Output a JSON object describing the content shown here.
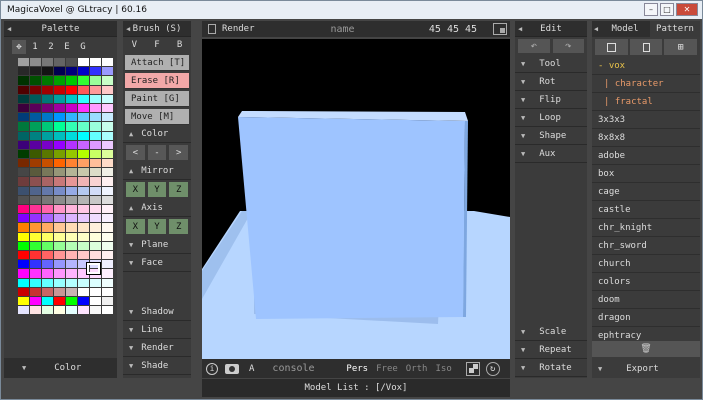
{
  "title": "MagicaVoxel @ GLtracy | 60.16",
  "window_controls": [
    "–",
    "□",
    "✕"
  ],
  "palette": {
    "header": "Palette",
    "tabs": [
      "✥",
      "1",
      "2",
      "E",
      "G"
    ],
    "footer": "Color",
    "colors": [
      "#a0a0a0",
      "#8c8c8c",
      "#787878",
      "#646464",
      "#505050",
      "#ffffff",
      "#ffffff",
      "#ffffff",
      "#282828",
      "#1e1e1e",
      "#141414",
      "#000050",
      "#00007c",
      "#0000c8",
      "#3232ff",
      "#9a9aff",
      "#003200",
      "#005000",
      "#007800",
      "#00a000",
      "#00c800",
      "#32ff32",
      "#9aff9a",
      "#c8ffc8",
      "#500000",
      "#780000",
      "#a00000",
      "#c80000",
      "#ff0000",
      "#ff5a5a",
      "#ff9a9a",
      "#ffc8c8",
      "#003c3c",
      "#005a5a",
      "#007878",
      "#00a0a0",
      "#00c8c8",
      "#32ffff",
      "#9affff",
      "#c8ffff",
      "#3c003c",
      "#5a005a",
      "#780078",
      "#a000a0",
      "#c800c8",
      "#ff32ff",
      "#ff9aff",
      "#ffc8ff",
      "#003c78",
      "#005aa0",
      "#0078c8",
      "#0096ff",
      "#32b4ff",
      "#64c8ff",
      "#9adcff",
      "#c8ecff",
      "#00783c",
      "#00a05a",
      "#00c878",
      "#00ff96",
      "#32ffb4",
      "#64ffc8",
      "#9affdc",
      "#c8ffec",
      "#006464",
      "#008282",
      "#00a0a0",
      "#00bebe",
      "#00dcdc",
      "#00ffff",
      "#64ffff",
      "#aaffff",
      "#3c0078",
      "#5a00a0",
      "#7800c8",
      "#9600ff",
      "#b432ff",
      "#c864ff",
      "#dc9aff",
      "#ecc8ff",
      "#003c00",
      "#3c5a00",
      "#5a7800",
      "#78a000",
      "#96c800",
      "#b4ff00",
      "#c8ff64",
      "#dcff9a",
      "#782800",
      "#a03c00",
      "#c85000",
      "#ff6400",
      "#ff8232",
      "#ffa064",
      "#ffbe9a",
      "#ffdcc8",
      "#464646",
      "#5a5a3c",
      "#78785a",
      "#969678",
      "#b4b496",
      "#c8c8aa",
      "#dcdcc8",
      "#f0f0e6",
      "#6e3c3c",
      "#8c5050",
      "#aa6464",
      "#c87878",
      "#e69696",
      "#f0b4b4",
      "#f8d2d2",
      "#fff0f0",
      "#3c506e",
      "#50648c",
      "#6478aa",
      "#788cc8",
      "#96aae6",
      "#b4c8f0",
      "#d2dcf8",
      "#f0f4ff",
      "#505050",
      "#646464",
      "#787878",
      "#8c8c8c",
      "#a0a0a0",
      "#b4b4b4",
      "#c8c8c8",
      "#dcdcdc",
      "#ff0080",
      "#ff3296",
      "#ff64aa",
      "#ff96c8",
      "#ffb4dc",
      "#ffc8e6",
      "#ffdcf0",
      "#fff0f8",
      "#8000ff",
      "#9632ff",
      "#aa64ff",
      "#c896ff",
      "#dcb4ff",
      "#e6c8ff",
      "#f0dcff",
      "#f8f0ff",
      "#ff8000",
      "#ff9632",
      "#ffaa64",
      "#ffc896",
      "#ffdcb4",
      "#ffe6c8",
      "#fff0dc",
      "#fff8f0",
      "#ffff00",
      "#ffff32",
      "#ffff64",
      "#ffff96",
      "#ffffb4",
      "#ffffc8",
      "#ffffdc",
      "#fffff0",
      "#00ff00",
      "#32ff32",
      "#64ff64",
      "#96ff96",
      "#b4ffb4",
      "#c8ffc8",
      "#dcffdc",
      "#f0fff0",
      "#ff0000",
      "#ff3232",
      "#ff6464",
      "#ff9696",
      "#ffb4b4",
      "#ffc8c8",
      "#ffdcdc",
      "#fff0f0",
      "#0000ff",
      "#3232ff",
      "#6464ff",
      "#9696ff",
      "#b4b4ff",
      "#c8c8ff",
      "#dcdcff",
      "#f0f0ff",
      "#ff00ff",
      "#ff32ff",
      "#ff64ff",
      "#ff96ff",
      "#ffb4ff",
      "#ffc8ff",
      "#ffdcff",
      "#fff0ff",
      "#00ffff",
      "#32ffff",
      "#64ffff",
      "#96ffff",
      "#b4ffff",
      "#c8ffff",
      "#dcffff",
      "#f0ffff",
      "#c80000",
      "#c83232",
      "#c86464",
      "#c89696",
      "#c8b4b4",
      "#ffffff",
      "#ffffff",
      "#ffffff",
      "#ffff00",
      "#ff00ff",
      "#00ffff",
      "#ff0000",
      "#00ff00",
      "#0000ff",
      "#ffffff",
      "#f0f0f0",
      "#e4e4ff",
      "#ffe4e4",
      "#e4ffe4",
      "#ffffe4",
      "#e4ffff",
      "#ffe4ff",
      "#f8f8f8",
      "#ffffff"
    ]
  },
  "brush": {
    "header": "Brush (S)",
    "tabs": [
      "V",
      "F",
      "B"
    ],
    "modes": [
      {
        "label": "Attach [T]",
        "color": "#b0b0b0"
      },
      {
        "label": "Erase  [R]",
        "color": "#f2a8a8"
      },
      {
        "label": "Paint  [G]",
        "color": "#b0b0b0"
      },
      {
        "label": "Move   [M]",
        "color": "#b0b0b0"
      }
    ],
    "color_section": "Color",
    "color_buttons": [
      "<",
      "-",
      ">"
    ],
    "mirror_section": "Mirror",
    "mirror_buttons": [
      "X",
      "Y",
      "Z"
    ],
    "axis_section": "Axis",
    "axis_buttons": [
      "X",
      "Y",
      "Z"
    ],
    "plane_section": "Plane",
    "face_section": "Face",
    "bottom_sections": [
      "Shadow",
      "Line",
      "Render",
      "Shade"
    ]
  },
  "toolbar": {
    "render": "Render",
    "name": "name",
    "size": "45 45 45"
  },
  "viewport": {
    "bottom": {
      "console": "console",
      "modes": [
        "Pers",
        "Free",
        "Orth",
        "Iso"
      ],
      "a_label": "A"
    },
    "status": "Model List : [/Vox]",
    "cube_color": "#9ec4ff"
  },
  "edit": {
    "header": "Edit",
    "tools": [
      "Tool",
      "Rot",
      "Flip",
      "Loop",
      "Shape",
      "Aux"
    ],
    "bottom_tools": [
      "Scale",
      "Repeat",
      "Rotate"
    ]
  },
  "model": {
    "tabs": [
      "Model",
      "Pattern"
    ],
    "items": [
      {
        "label": "- vox",
        "kind": "vox"
      },
      {
        "label": "| character",
        "kind": "sub"
      },
      {
        "label": "| fractal",
        "kind": "sub"
      },
      {
        "label": "3x3x3",
        "kind": "item"
      },
      {
        "label": "8x8x8",
        "kind": "item"
      },
      {
        "label": "adobe",
        "kind": "item"
      },
      {
        "label": "box",
        "kind": "item"
      },
      {
        "label": "cage",
        "kind": "item"
      },
      {
        "label": "castle",
        "kind": "item"
      },
      {
        "label": "chr_knight",
        "kind": "item"
      },
      {
        "label": "chr_sword",
        "kind": "item"
      },
      {
        "label": "church",
        "kind": "item"
      },
      {
        "label": "colors",
        "kind": "item"
      },
      {
        "label": "doom",
        "kind": "item"
      },
      {
        "label": "dragon",
        "kind": "item"
      },
      {
        "label": "ephtracy",
        "kind": "item"
      }
    ],
    "footer": "Export"
  }
}
